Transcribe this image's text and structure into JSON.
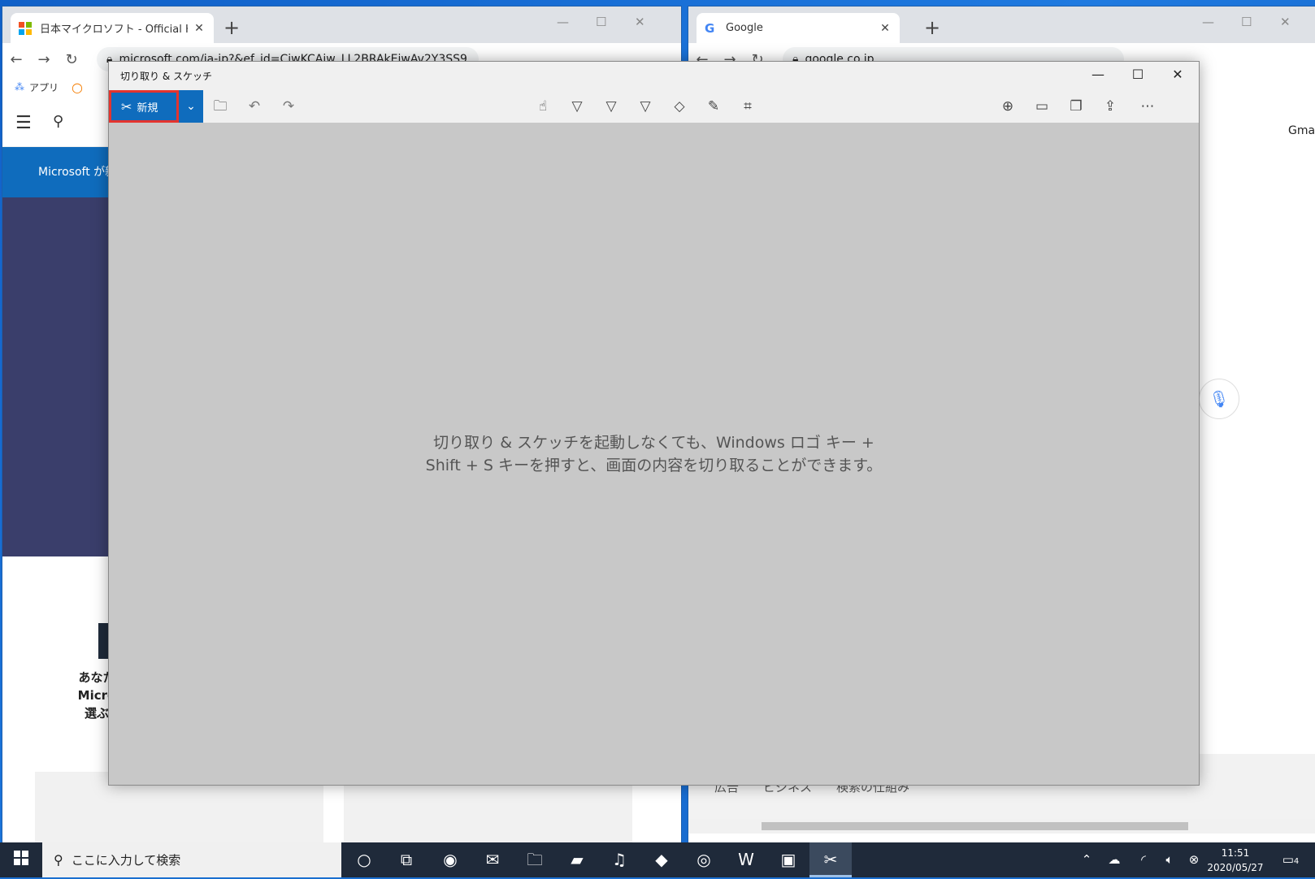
{
  "left_browser": {
    "tab_title": "日本マイクロソフト - Official Home",
    "address": "microsoft.com/ja-jp?&ef_id=CjwKCAjw_LL2BRAkEiwAv2Y3SS9",
    "bookmark_apps": "アプリ",
    "banner_text": "Microsoft が新",
    "section_text": [
      "あなた",
      "Micro",
      "選ぶ"
    ]
  },
  "right_browser": {
    "tab_title": "Google",
    "address": "google.co.jp",
    "gmail_partial": "Gma",
    "footer_links": [
      "広告",
      "ビジネス",
      "検索の仕組み"
    ]
  },
  "snip_window": {
    "title": "切り取り & スケッチ",
    "new_button_label": "新規",
    "message_line1": "切り取り & スケッチを起動しなくても、Windows ロゴ キー +",
    "message_line2": "Shift + S キーを押すと、画面の内容を切り取ることができます。"
  },
  "taskbar": {
    "search_placeholder": "ここに入力して検索",
    "time": "11:51",
    "date": "2020/05/27",
    "notification_count": "4"
  },
  "colors": {
    "snip_accent": "#0f6cbd",
    "highlight_border": "#e3342f",
    "taskbar_bg": "#1f2a3a"
  }
}
